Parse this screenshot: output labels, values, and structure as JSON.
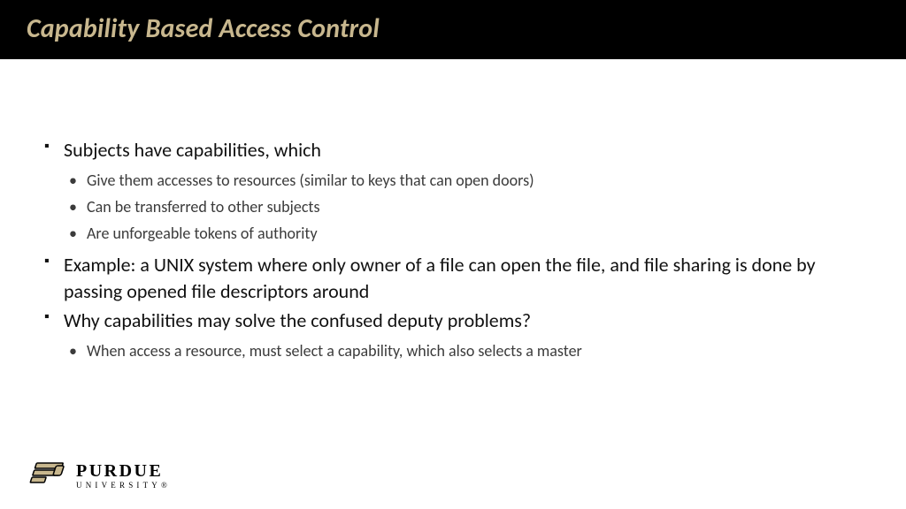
{
  "title": "Capability Based Access Control",
  "bullets": [
    {
      "text": "Subjects have capabilities, which",
      "sub": [
        "Give them accesses to resources (similar to keys that can open doors)",
        "Can be transferred to other subjects",
        "Are unforgeable tokens of authority"
      ]
    },
    {
      "text": "Example: a UNIX system where only owner of a file can open the file, and file sharing is done by passing opened file descriptors around",
      "sub": []
    },
    {
      "text": "Why capabilities may solve the confused deputy problems?",
      "sub": [
        "When access a resource, must select a capability, which also selects a master"
      ]
    }
  ],
  "logo": {
    "name": "PURDUE",
    "sub": "UNIVERSITY",
    "reg": "®"
  },
  "colors": {
    "titleText": "#C8B78E",
    "titleBg": "#000000",
    "body": "#111111",
    "subBody": "#3b3b3b",
    "logoGold": "#C8B78E"
  }
}
